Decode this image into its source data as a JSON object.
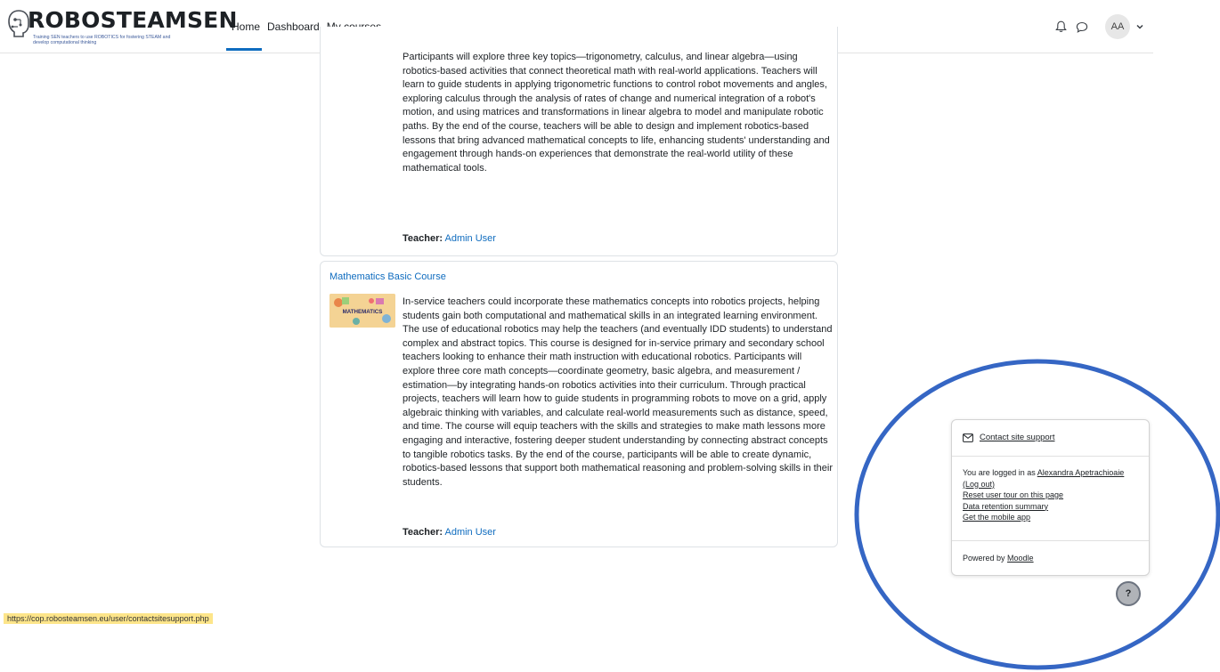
{
  "brand": {
    "name": "ROBOSTEAMSEN",
    "tagline_line1": "Training SEN teachers to use ROBOTICS for fostering STEAM and",
    "tagline_line2": "develop computational thinking"
  },
  "nav": {
    "links": [
      {
        "label": "Home",
        "active": true
      },
      {
        "label": "Dashboard",
        "active": false
      },
      {
        "label": "My courses",
        "active": false
      }
    ],
    "user_initials": "AA",
    "icons": [
      "bell-icon",
      "chat-icon",
      "chevron-down-icon"
    ]
  },
  "courses": [
    {
      "title": "",
      "summary": "Participants will explore three key topics—trigonometry, calculus, and linear algebra—using robotics-based activities that connect theoretical math with real-world applications. Teachers will learn to guide students in applying trigonometric functions to control robot movements and angles, exploring calculus through the analysis of rates of change and numerical integration of a robot's motion, and using matrices and transformations in linear algebra to model and manipulate robotic paths. By the end of the course, teachers will be able to design and implement robotics-based lessons that bring advanced mathematical concepts to life, enhancing students' understanding and engagement through hands-on experiences that demonstrate the real-world utility of these mathematical tools.",
      "teacher_label": "Teacher:",
      "teacher_name": "Admin User"
    },
    {
      "title": "Mathematics Basic Course",
      "thumb_label": "MATHEMATICS",
      "summary": "In-service teachers could incorporate these mathematics concepts into robotics projects, helping students gain both computational and mathematical skills in an integrated learning environment. The use of educational robotics may help the teachers (and eventually IDD students) to understand complex and abstract topics. This course is designed for in-service primary and secondary school teachers looking to enhance their math instruction with educational robotics. Participants will explore three core math concepts—coordinate geometry, basic algebra, and measurement / estimation—by integrating hands-on robotics activities into their curriculum. Through practical projects, teachers will learn how to guide students in programming robots to move on a grid, apply algebraic thinking with variables, and calculate real-world measurements such as distance, speed, and time. The course will equip teachers with the skills and strategies to make math lessons more engaging and interactive, fostering deeper student understanding by connecting abstract concepts to tangible robotics tasks. By the end of the course, participants will be able to create dynamic, robotics-based lessons that support both mathematical reasoning and problem-solving skills in their students.",
      "teacher_label": "Teacher:",
      "teacher_name": "Admin User"
    }
  ],
  "footer": {
    "contact_label": "Contact site support",
    "logged_in_prefix": "You are logged in as",
    "user_full_name": "Alexandra Apetrachioaie",
    "logout_label": "(Log out)",
    "reset_tour_label": "Reset user tour on this page",
    "data_retention_label": "Data retention summary",
    "mobile_app_label": "Get the mobile app",
    "powered_by_prefix": "Powered by",
    "powered_by_link": "Moodle",
    "help_label": "?"
  },
  "status_bar": {
    "url": "https://cop.robosteamsen.eu/user/contactsitesupport.php"
  },
  "colors": {
    "link": "#0f6cbf",
    "annotation": "#3566c4",
    "status_bg": "#fde58a"
  }
}
